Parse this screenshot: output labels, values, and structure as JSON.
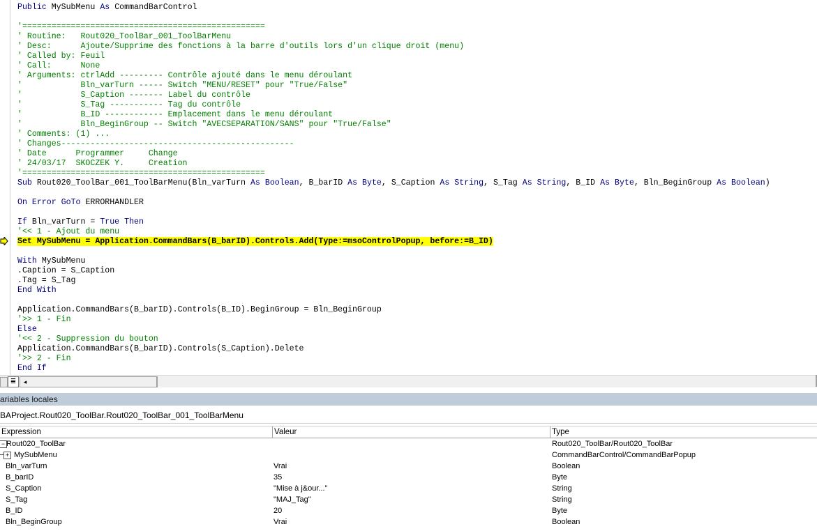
{
  "editor": {
    "code_lines": [
      {
        "text": "Public MySubMenu As CommandBarControl",
        "style": "mixed"
      },
      {
        "text": "",
        "style": "plain"
      },
      {
        "text": "'==================================================",
        "style": "comment"
      },
      {
        "text": "' Routine:   Rout020_ToolBar_001_ToolBarMenu",
        "style": "comment"
      },
      {
        "text": "' Desc:      Ajoute/Supprime des fonctions à la barre d'outils lors d'un clique droit (menu)",
        "style": "comment"
      },
      {
        "text": "' Called by: Feuil",
        "style": "comment"
      },
      {
        "text": "' Call:      None",
        "style": "comment"
      },
      {
        "text": "' Arguments: ctrlAdd --------- Contrôle ajouté dans le menu déroulant",
        "style": "comment"
      },
      {
        "text": "'            Bln_varTurn ----- Switch \"MENU/RESET\" pour \"True/False\"",
        "style": "comment"
      },
      {
        "text": "'            S_Caption ------- Label du contrôle",
        "style": "comment"
      },
      {
        "text": "'            S_Tag ----------- Tag du contrôle",
        "style": "comment"
      },
      {
        "text": "'            B_ID ------------ Emplacement dans le menu déroulant",
        "style": "comment"
      },
      {
        "text": "'            Bln_BeginGroup -- Switch \"AVECSEPARATION/SANS\" pour \"True/False\"",
        "style": "comment"
      },
      {
        "text": "' Comments: (1) ...",
        "style": "comment"
      },
      {
        "text": "' Changes------------------------------------------------",
        "style": "comment"
      },
      {
        "text": "' Date      Programmer     Change",
        "style": "comment"
      },
      {
        "text": "' 24/03/17  SKOCZEK Y.     Creation",
        "style": "comment"
      },
      {
        "text": "'==================================================",
        "style": "comment"
      },
      {
        "text": "Sub Rout020_ToolBar_001_ToolBarMenu(Bln_varTurn As Boolean, B_barID As Byte, S_Caption As String, S_Tag As String, B_ID As Byte, Bln_BeginGroup As Boolean)",
        "style": "mixed"
      },
      {
        "text": "",
        "style": "plain"
      },
      {
        "text": "On Error GoTo ERRORHANDLER",
        "style": "mixed"
      },
      {
        "text": "",
        "style": "plain"
      },
      {
        "text": "If Bln_varTurn = True Then",
        "style": "mixed"
      },
      {
        "text": "'<< 1 - Ajout du menu",
        "style": "comment"
      },
      {
        "text": "Set MySubMenu = Application.CommandBars(B_barID).Controls.Add(Type:=msoControlPopup, before:=B_ID)",
        "style": "highlight"
      },
      {
        "text": "",
        "style": "plain"
      },
      {
        "text": "With MySubMenu",
        "style": "mixed"
      },
      {
        "text": ".Caption = S_Caption",
        "style": "plain"
      },
      {
        "text": ".Tag = S_Tag",
        "style": "plain"
      },
      {
        "text": "End With",
        "style": "mixed"
      },
      {
        "text": "",
        "style": "plain"
      },
      {
        "text": "Application.CommandBars(B_barID).Controls(B_ID).BeginGroup = Bln_BeginGroup",
        "style": "plain"
      },
      {
        "text": "'>> 1 - Fin",
        "style": "comment"
      },
      {
        "text": "Else",
        "style": "mixed"
      },
      {
        "text": "'<< 2 - Suppression du bouton",
        "style": "comment"
      },
      {
        "text": "Application.CommandBars(B_barID).Controls(S_Caption).Delete",
        "style": "plain"
      },
      {
        "text": "'>> 2 - Fin",
        "style": "comment"
      },
      {
        "text": "End If",
        "style": "mixed"
      }
    ],
    "keywords": [
      "Public",
      "As",
      "Sub",
      "Boolean",
      "Byte",
      "String",
      "On",
      "Error",
      "GoTo",
      "If",
      "True",
      "Then",
      "With",
      "End",
      "Else"
    ],
    "colors": {
      "keyword": "#00007f",
      "comment": "#007f00",
      "highlight": "#ffff00"
    },
    "exec_indicator_icon": "arrow-right-icon",
    "view_button_icon": "full-module-view-icon",
    "scroll_left_glyph": "◂"
  },
  "locals": {
    "title": "ariables locales",
    "context": "BAProject.Rout020_ToolBar.Rout020_ToolBar_001_ToolBarMenu",
    "columns": [
      "Expression",
      "Valeur",
      "Type"
    ],
    "rows": [
      {
        "expression": "Rout020_ToolBar",
        "value": "",
        "type": "Rout020_ToolBar/Rout020_ToolBar",
        "tree": "minus",
        "indent": 0
      },
      {
        "expression": "MySubMenu",
        "value": "",
        "type": "CommandBarControl/CommandBarPopup",
        "tree": "plus",
        "indent": 1
      },
      {
        "expression": "Bln_varTurn",
        "value": "Vrai",
        "type": "Boolean",
        "tree": "none",
        "indent": 1
      },
      {
        "expression": "B_barID",
        "value": "35",
        "type": "Byte",
        "tree": "none",
        "indent": 1
      },
      {
        "expression": "S_Caption",
        "value": "\"Mise à j&our...\"",
        "type": "String",
        "tree": "none",
        "indent": 1
      },
      {
        "expression": "S_Tag",
        "value": "\"MAJ_Tag\"",
        "type": "String",
        "tree": "none",
        "indent": 1
      },
      {
        "expression": "B_ID",
        "value": "20",
        "type": "Byte",
        "tree": "none",
        "indent": 1
      },
      {
        "expression": "Bln_BeginGroup",
        "value": "Vrai",
        "type": "Boolean",
        "tree": "none",
        "indent": 1
      }
    ],
    "tree_glyphs": {
      "minus": "−",
      "plus": "+"
    }
  }
}
